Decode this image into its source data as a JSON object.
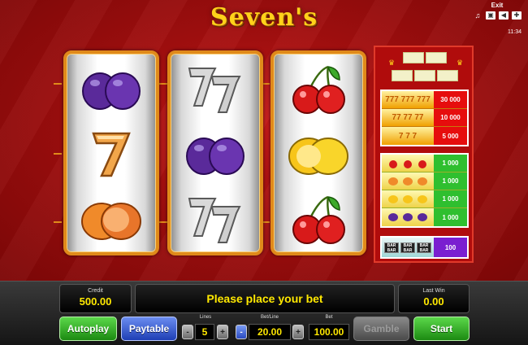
{
  "game": {
    "title": "Seven's"
  },
  "topbar": {
    "exit_label": "Exit",
    "clock": "11:34",
    "icons": [
      "music-icon",
      "fullscreen-icon",
      "sound-icon",
      "settings-icon"
    ]
  },
  "reels": [
    [
      "plum",
      "seven",
      "orange"
    ],
    [
      "seven-pair",
      "plum",
      "seven-pair"
    ],
    [
      "cherry",
      "lemon",
      "cherry"
    ]
  ],
  "paytable": {
    "sevens": [
      {
        "symbols": "777 777 777",
        "value": "30 000"
      },
      {
        "symbols": "77 77 77",
        "value": "10 000"
      },
      {
        "symbols": "7 7 7",
        "value": "5 000"
      }
    ],
    "fruits": [
      {
        "symbol": "cherry",
        "value": "1 000"
      },
      {
        "symbol": "orange",
        "value": "1 000"
      },
      {
        "symbol": "lemon",
        "value": "1 000"
      },
      {
        "symbol": "plum",
        "value": "1 000"
      }
    ],
    "bar": {
      "value": "100",
      "bar_text": "BAR"
    }
  },
  "panel": {
    "credit_label": "Credit",
    "credit_value": "500.00",
    "message": "Please place your bet",
    "last_win_label": "Last Win",
    "last_win_value": "0.00",
    "autoplay_label": "Autoplay",
    "paytable_label": "Paytable",
    "lines_label": "Lines",
    "lines_value": "5",
    "bet_line_label": "Bet/Line",
    "bet_line_value": "20.00",
    "bet_label": "Bet",
    "bet_value": "100.00",
    "gamble_label": "Gamble",
    "start_label": "Start",
    "minus": "-",
    "plus": "+"
  },
  "colors": {
    "accent_gold": "#ffd21a",
    "reel_border": "#e08a1a",
    "display_text": "#ffe800",
    "button_green": "#2fa81e",
    "button_blue": "#2f4fc8"
  }
}
